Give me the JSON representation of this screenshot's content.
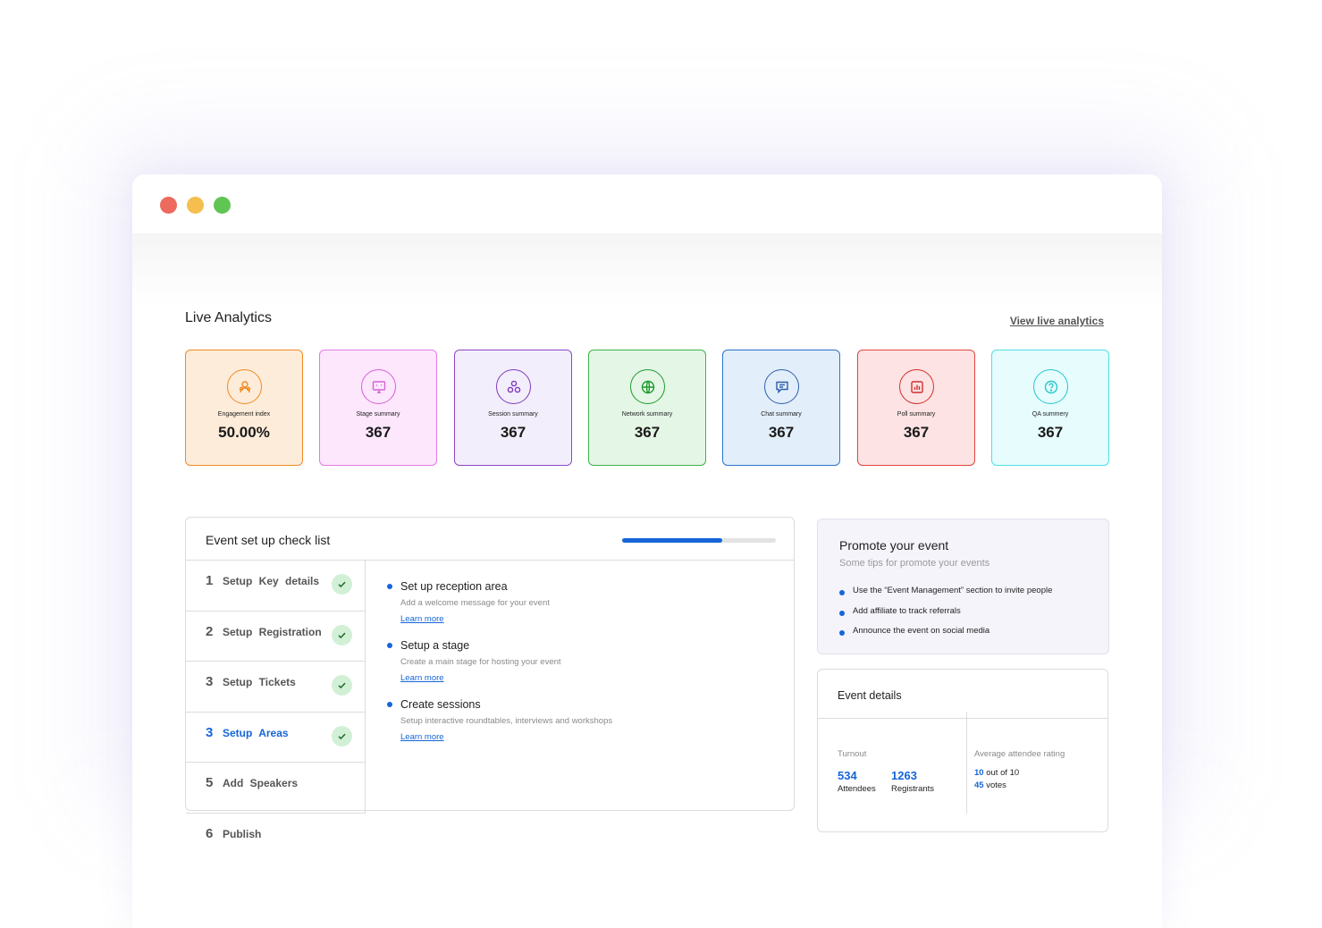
{
  "analytics": {
    "title": "Live Analytics",
    "view_link": "View live analytics",
    "cards": [
      {
        "label": "Engagement index",
        "value": "50.00%",
        "icon": "people-icon",
        "border": "#f08a24",
        "bg": "#fdecd9",
        "icon_color": "#f08a24"
      },
      {
        "label": "Stage summary",
        "value": "367",
        "icon": "screen-icon",
        "border": "#e37be3",
        "bg": "#fce7fc",
        "icon_color": "#d562d5"
      },
      {
        "label": "Session summary",
        "value": "367",
        "icon": "cluster-icon",
        "border": "#8e44c6",
        "bg": "#f3eefb",
        "icon_color": "#7e3bc0"
      },
      {
        "label": "Network summary",
        "value": "367",
        "icon": "globe-icon",
        "border": "#3fb24e",
        "bg": "#e4f6e5",
        "icon_color": "#1f9a2f"
      },
      {
        "label": "Chat summary",
        "value": "367",
        "icon": "chat-icon",
        "border": "#2d73c7",
        "bg": "#e3eefb",
        "icon_color": "#2d5fa8"
      },
      {
        "label": "Poll summary",
        "value": "367",
        "icon": "poll-icon",
        "border": "#e0453e",
        "bg": "#fde3e3",
        "icon_color": "#d22f2f"
      },
      {
        "label": "QA summery",
        "value": "367",
        "icon": "question-icon",
        "border": "#4fe0e3",
        "bg": "#e6fcfd",
        "icon_color": "#29c6cc"
      }
    ]
  },
  "checklist": {
    "title": "Event set up check list",
    "progress": 0.65,
    "steps": [
      {
        "num": "1",
        "label": "Setup Key details",
        "done": true,
        "active": false
      },
      {
        "num": "2",
        "label": "Setup Registration",
        "done": true,
        "active": false
      },
      {
        "num": "3",
        "label": "Setup Tickets",
        "done": true,
        "active": false
      },
      {
        "num": "3",
        "label": "Setup Areas",
        "done": true,
        "active": true
      },
      {
        "num": "5",
        "label": "Add Speakers",
        "done": false,
        "active": false
      },
      {
        "num": "6",
        "label": "Publish",
        "done": false,
        "active": false
      }
    ],
    "tasks": [
      {
        "title": "Set up reception area",
        "desc": "Add a welcome message for your event",
        "link": "Learn more"
      },
      {
        "title": "Setup a stage",
        "desc": "Create a main stage for hosting your event",
        "link": "Learn more"
      },
      {
        "title": "Create sessions",
        "desc": "Setup interactive roundtables, interviews and workshops",
        "link": "Learn more"
      }
    ]
  },
  "promote": {
    "title": "Promote your event",
    "subtitle": "Some tips for promote your events",
    "tips": [
      "Use the “Event Management” section to invite people",
      "Add affiliate to track referrals",
      "Announce the event on social media"
    ]
  },
  "details": {
    "title": "Event details",
    "turnout_label": "Turnout",
    "attendees_value": "534",
    "attendees_label": "Attendees",
    "registrants_value": "1263",
    "registrants_label": "Registrants",
    "rating_label": "Average attendee rating",
    "rating_value": "10",
    "rating_suffix": " out of 10",
    "votes_value": "45",
    "votes_suffix": " votes"
  },
  "colors": {
    "accent": "#1565d8",
    "check_bg": "#d2f0d6",
    "check_fg": "#1b6b2a"
  }
}
